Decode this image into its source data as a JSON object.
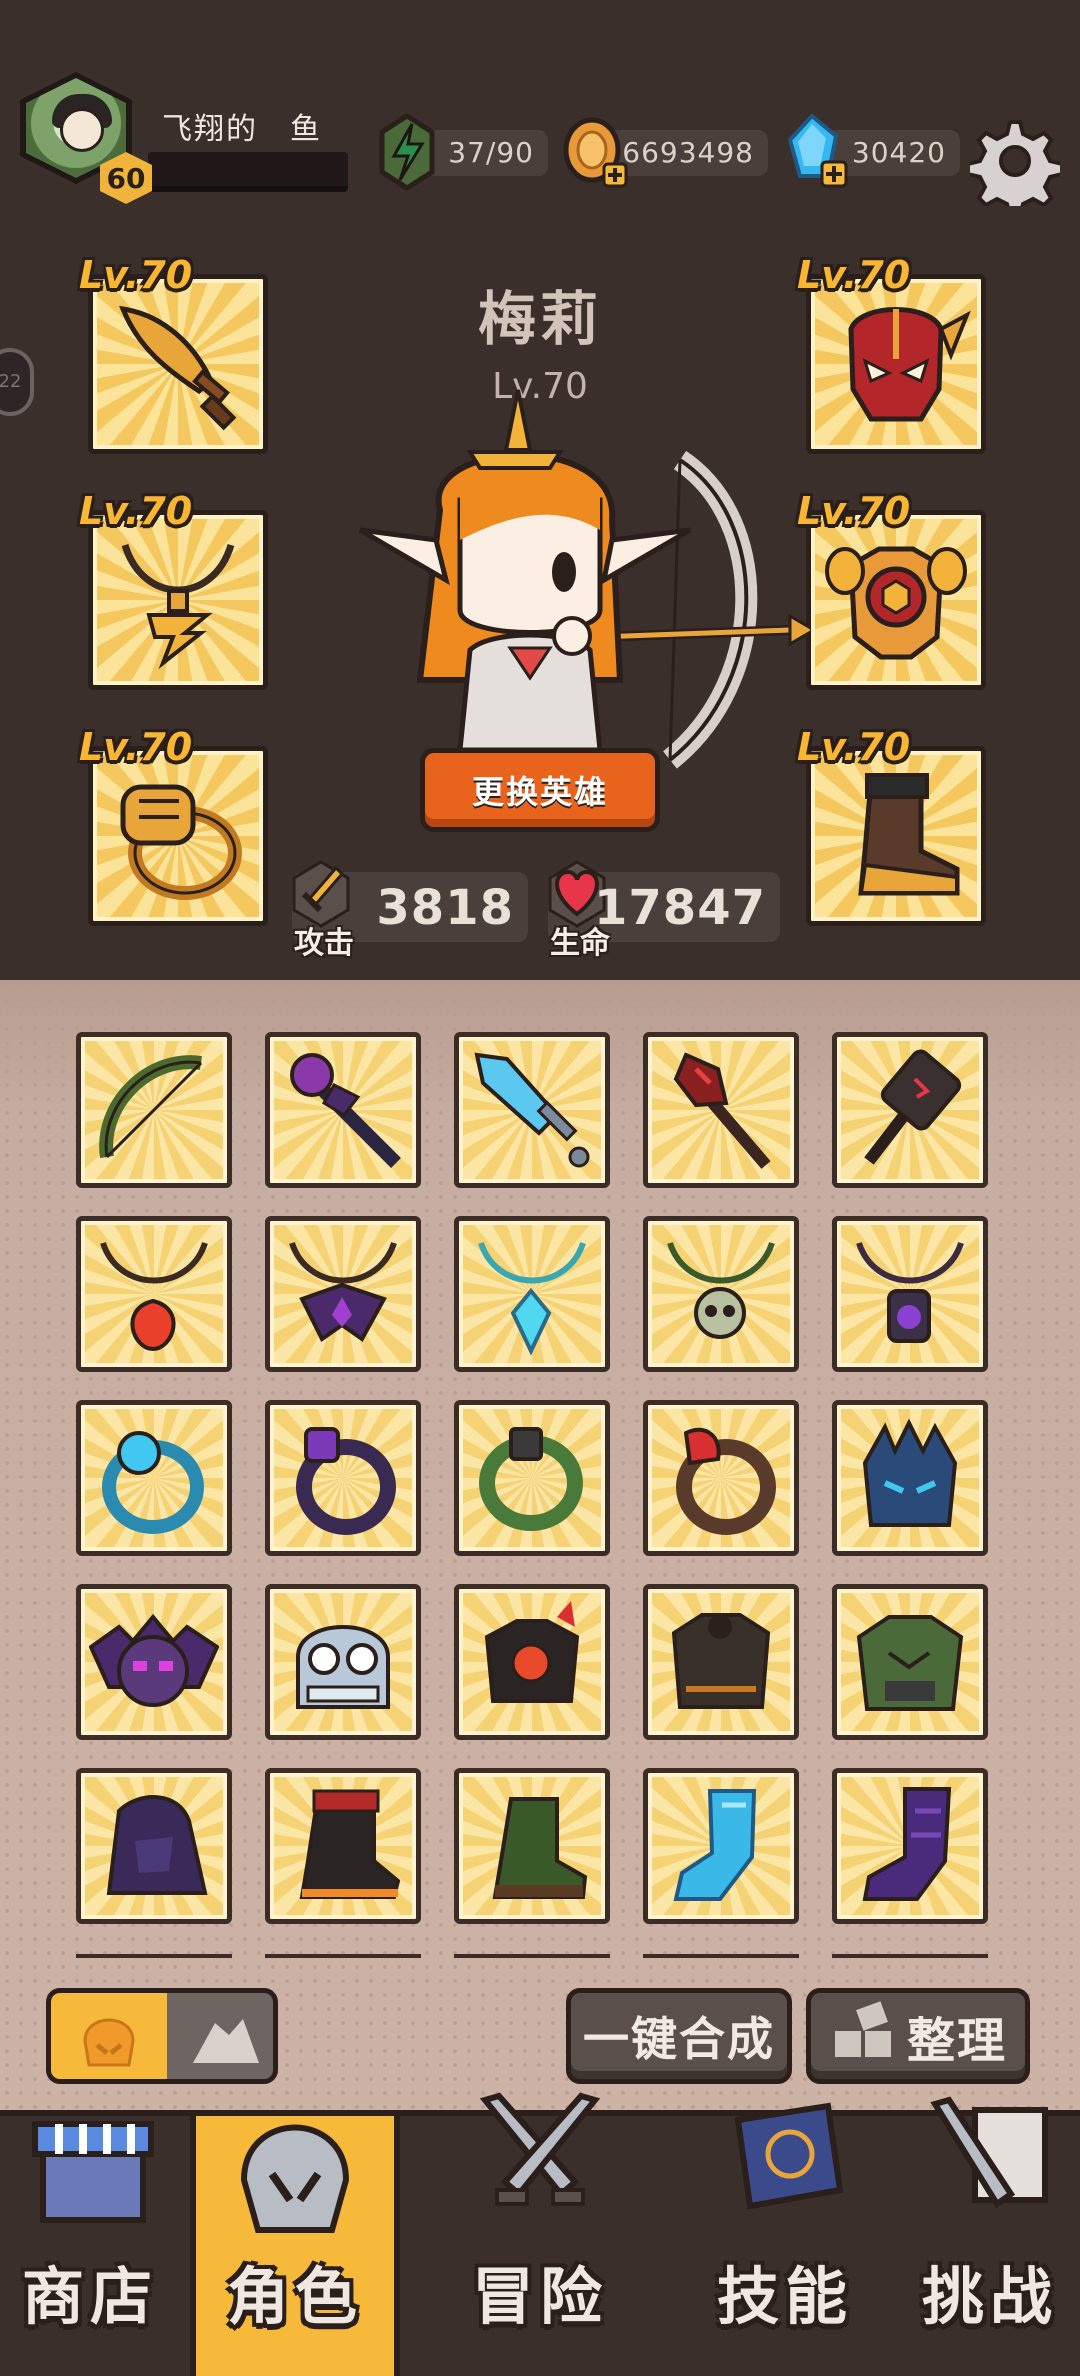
{
  "player": {
    "name": "飞翔的　鱼",
    "level": "60"
  },
  "resources": {
    "energy": "37/90",
    "coins": "6693498",
    "gems": "30420"
  },
  "side_pill": "22",
  "hero": {
    "name": "梅莉",
    "level": "Lv.70",
    "change_button": "更换英雄",
    "attack_label": "攻击",
    "attack_value": "3818",
    "hp_label": "生命",
    "hp_value": "17847"
  },
  "equipment": [
    {
      "slot": "weapon",
      "level": "Lv.70",
      "icon": "golden-sword-icon"
    },
    {
      "slot": "necklace",
      "level": "Lv.70",
      "icon": "golden-necklace-icon"
    },
    {
      "slot": "ring",
      "level": "Lv.70",
      "icon": "fist-ring-icon"
    },
    {
      "slot": "helmet",
      "level": "Lv.70",
      "icon": "red-mask-helmet-icon"
    },
    {
      "slot": "armor",
      "level": "Lv.70",
      "icon": "golden-armor-icon"
    },
    {
      "slot": "boots",
      "level": "Lv.70",
      "icon": "armored-boot-icon"
    }
  ],
  "inventory": [
    [
      "bow-icon",
      "purple-staff-icon",
      "blue-sword-icon",
      "red-torch-staff-icon",
      "dark-hammer-icon"
    ],
    [
      "red-pendant-icon",
      "purple-pendant-icon",
      "crystal-pendant-icon",
      "skull-necklace-icon",
      "lantern-pendant-icon"
    ],
    [
      "blue-orb-ring-icon",
      "purple-gem-ring-icon",
      "vine-ring-icon",
      "flame-ring-icon",
      "spiked-blue-helmet-icon"
    ],
    [
      "bat-helmet-icon",
      "goggle-helmet-icon",
      "fire-golem-armor-icon",
      "dark-chest-armor-icon",
      "green-goblin-armor-icon"
    ],
    [
      "shadow-cloak-icon",
      "fire-boot-icon",
      "leaf-boot-icon",
      "ice-boot-icon",
      "purple-boot-icon"
    ]
  ],
  "controls": {
    "merge_label": "一键合成",
    "sort_label": "整理"
  },
  "nav": [
    {
      "label": "商店",
      "icon": "shop-icon"
    },
    {
      "label": "角色",
      "icon": "helmet-icon"
    },
    {
      "label": "冒险",
      "icon": "crossed-swords-icon"
    },
    {
      "label": "技能",
      "icon": "spellbook-icon"
    },
    {
      "label": "挑战",
      "icon": "sword-scroll-icon"
    }
  ],
  "colors": {
    "background": "#3b2f2c",
    "accent": "#f6b93a",
    "button_orange": "#e8641c",
    "level_text": "#f8b632"
  }
}
